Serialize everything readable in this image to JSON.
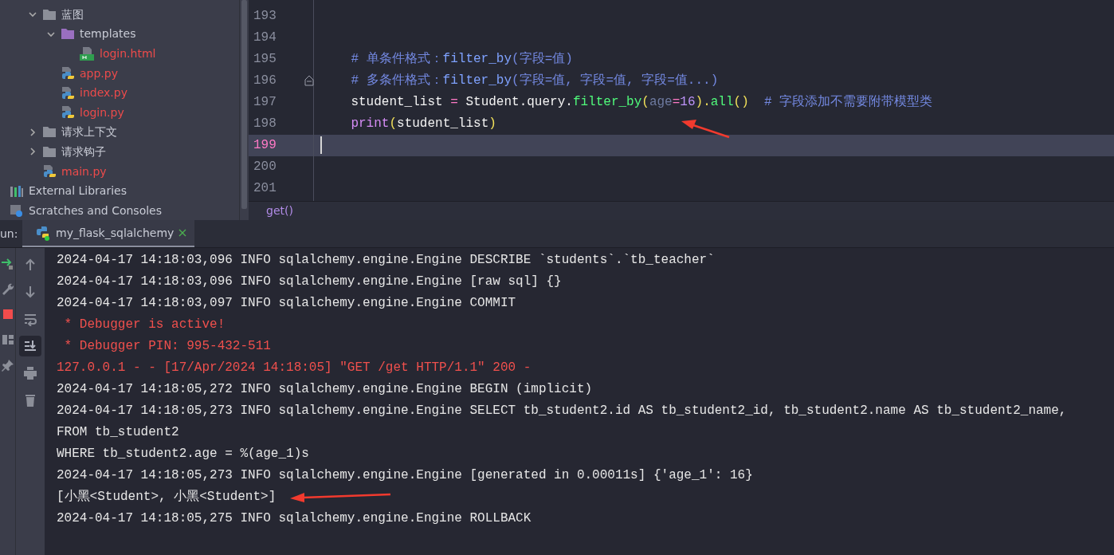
{
  "project_tree": [
    {
      "label": "蓝图",
      "kind": "folder",
      "expanded": true,
      "children": [
        {
          "label": "templates",
          "kind": "template-folder",
          "expanded": true,
          "children": [
            {
              "label": "login.html",
              "kind": "html",
              "untracked": true
            }
          ]
        },
        {
          "label": "app.py",
          "kind": "py",
          "untracked": true
        },
        {
          "label": "index.py",
          "kind": "py",
          "untracked": true
        },
        {
          "label": "login.py",
          "kind": "py",
          "untracked": true
        }
      ]
    },
    {
      "label": "请求上下文",
      "kind": "folder",
      "expanded": false
    },
    {
      "label": "请求钩子",
      "kind": "folder",
      "expanded": false
    },
    {
      "label": "main.py",
      "kind": "py",
      "untracked": true
    }
  ],
  "root_items": [
    {
      "label": "External Libraries",
      "kind": "libraries"
    },
    {
      "label": "Scratches and Consoles",
      "kind": "scratches"
    }
  ],
  "editor": {
    "lines": [
      {
        "number": "193",
        "current": false,
        "fold": false
      },
      {
        "number": "194",
        "current": false,
        "fold": false
      },
      {
        "number": "195",
        "current": false,
        "fold": false,
        "tokens": [
          {
            "text": "    # 单条件格式：",
            "kind": "comment"
          },
          {
            "text": "filter_by",
            "kind": "comment-code"
          },
          {
            "text": "(字段=值)",
            "kind": "comment"
          }
        ]
      },
      {
        "number": "196",
        "current": false,
        "fold": true,
        "tokens": [
          {
            "text": "    # 多条件格式：",
            "kind": "comment"
          },
          {
            "text": "filter_by",
            "kind": "comment-code"
          },
          {
            "text": "(字段=值, 字段=值, 字段=值...)",
            "kind": "comment"
          }
        ]
      },
      {
        "number": "197",
        "current": false,
        "fold": false,
        "tokens": [
          {
            "text": "    student_list ",
            "kind": "plain"
          },
          {
            "text": "=",
            "kind": "op"
          },
          {
            "text": " Student.query.",
            "kind": "plain"
          },
          {
            "text": "filter_by",
            "kind": "func"
          },
          {
            "text": "(",
            "kind": "paren"
          },
          {
            "text": "age",
            "kind": "param"
          },
          {
            "text": "=",
            "kind": "op"
          },
          {
            "text": "16",
            "kind": "number"
          },
          {
            "text": ").",
            "kind": "paren"
          },
          {
            "text": "all",
            "kind": "func"
          },
          {
            "text": "()",
            "kind": "paren"
          },
          {
            "text": "  # 字段添加不需要附带模型类",
            "kind": "comment"
          }
        ]
      },
      {
        "number": "198",
        "current": false,
        "fold": false,
        "tokens": [
          {
            "text": "    print",
            "kind": "builtin"
          },
          {
            "text": "(",
            "kind": "paren"
          },
          {
            "text": "student_list",
            "kind": "plain"
          },
          {
            "text": ")",
            "kind": "paren"
          }
        ]
      },
      {
        "number": "199",
        "current": true,
        "fold": false
      },
      {
        "number": "200",
        "current": false,
        "fold": false
      },
      {
        "number": "201",
        "current": false,
        "fold": false
      }
    ],
    "breadcrumb": "get()"
  },
  "run_panel": {
    "label": "un:",
    "tab": {
      "title": "my_flask_sqlalchemy",
      "selected": true
    }
  },
  "left_tools": [
    {
      "kind": "rerun"
    },
    {
      "kind": "wrench"
    },
    {
      "kind": "stop"
    },
    {
      "kind": "layout"
    },
    {
      "kind": "pin"
    }
  ],
  "console_tools": [
    {
      "kind": "up",
      "on": false
    },
    {
      "kind": "down",
      "on": false
    },
    {
      "kind": "wrap",
      "on": false
    },
    {
      "kind": "scroll-end",
      "on": true
    },
    {
      "kind": "print",
      "on": false
    },
    {
      "kind": "trash",
      "on": false
    }
  ],
  "console": [
    {
      "text": "2024-04-17 14:18:03,096 INFO sqlalchemy.engine.Engine DESCRIBE `students`.`tb_teacher`",
      "kind": "info"
    },
    {
      "text": "2024-04-17 14:18:03,096 INFO sqlalchemy.engine.Engine [raw sql] {}",
      "kind": "info"
    },
    {
      "text": "2024-04-17 14:18:03,097 INFO sqlalchemy.engine.Engine COMMIT",
      "kind": "info"
    },
    {
      "text": " * Debugger is active!",
      "kind": "error"
    },
    {
      "text": " * Debugger PIN: 995-432-511",
      "kind": "error"
    },
    {
      "text": "127.0.0.1 - - [17/Apr/2024 14:18:05] \"GET /get HTTP/1.1\" 200 -",
      "kind": "error"
    },
    {
      "text": "2024-04-17 14:18:05,272 INFO sqlalchemy.engine.Engine BEGIN (implicit)",
      "kind": "info"
    },
    {
      "text": "2024-04-17 14:18:05,273 INFO sqlalchemy.engine.Engine SELECT tb_student2.id AS tb_student2_id, tb_student2.name AS tb_student2_name,",
      "kind": "info"
    },
    {
      "text": "FROM tb_student2",
      "kind": "info"
    },
    {
      "text": "WHERE tb_student2.age = %(age_1)s",
      "kind": "info"
    },
    {
      "text": "2024-04-17 14:18:05,273 INFO sqlalchemy.engine.Engine [generated in 0.00011s] {'age_1': 16}",
      "kind": "info"
    },
    {
      "text": "[小黑<Student>, 小黑<Student>]",
      "kind": "info"
    },
    {
      "text": "2024-04-17 14:18:05,275 INFO sqlalchemy.engine.Engine ROLLBACK",
      "kind": "info"
    }
  ]
}
